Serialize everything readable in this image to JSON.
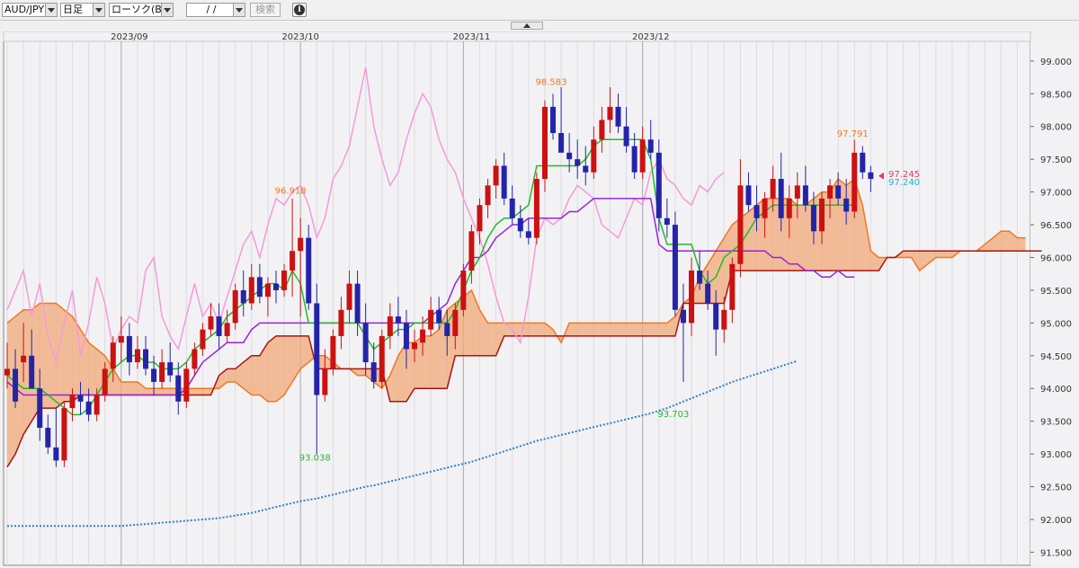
{
  "toolbar": {
    "pair": "AUD/JPY",
    "timeframe": "日足",
    "chart_type": "ローソク(BID)",
    "date_value": "/ /",
    "search_label": "検索",
    "info_glyph": "i"
  },
  "chart_data": {
    "type": "candlestick",
    "x_labels": [
      "2023/09",
      "2023/10",
      "2023/11",
      "2023/12"
    ],
    "y_ticks": [
      "99.000",
      "98.500",
      "98.000",
      "97.500",
      "97.000",
      "96.500",
      "96.000",
      "95.500",
      "95.000",
      "94.500",
      "94.000",
      "93.500",
      "93.000",
      "92.500",
      "92.000",
      "91.500"
    ],
    "ylim": [
      91.3,
      99.3
    ],
    "annotations": [
      {
        "text": "96.918",
        "value": 96.918,
        "color": "#f07820"
      },
      {
        "text": "93.038",
        "value": 93.038,
        "color": "#22bb22"
      },
      {
        "text": "98.583",
        "value": 98.583,
        "color": "#f07820"
      },
      {
        "text": "93.703",
        "value": 93.703,
        "color": "#22bb22"
      },
      {
        "text": "97.791",
        "value": 97.791,
        "color": "#f07820"
      }
    ],
    "price_labels": [
      {
        "text": "97.245",
        "value": 97.245,
        "color": "#e8386a"
      },
      {
        "text": "97.240",
        "value": 97.24,
        "color": "#29a8e0"
      }
    ],
    "colors": {
      "up": "#cc1111",
      "down": "#2424aa",
      "tenkan": "#22bb22",
      "kijun": "#9a22dd",
      "chikou": "#f59ad8",
      "span_a": "#f07820",
      "span_b": "#aa1414",
      "cloud": "#f2a878",
      "ma": "#2e7fd0"
    },
    "ohlc": [
      [
        94.2,
        94.7,
        94.0,
        94.3
      ],
      [
        94.3,
        94.6,
        93.7,
        93.8
      ],
      [
        94.4,
        95.0,
        94.1,
        94.5
      ],
      [
        94.5,
        94.9,
        94.3,
        94.0
      ],
      [
        94.0,
        94.3,
        93.2,
        93.4
      ],
      [
        93.4,
        93.6,
        93.0,
        93.1
      ],
      [
        93.1,
        93.7,
        92.8,
        92.9
      ],
      [
        92.9,
        93.8,
        92.8,
        93.7
      ],
      [
        93.7,
        94.0,
        93.5,
        93.9
      ],
      [
        93.9,
        94.1,
        93.6,
        93.8
      ],
      [
        93.8,
        94.0,
        93.5,
        93.6
      ],
      [
        93.6,
        94.0,
        93.5,
        93.9
      ],
      [
        93.9,
        94.4,
        93.8,
        94.3
      ],
      [
        94.3,
        94.8,
        94.1,
        94.7
      ],
      [
        94.7,
        95.1,
        94.4,
        94.8
      ],
      [
        94.8,
        95.0,
        94.2,
        94.4
      ],
      [
        94.4,
        94.8,
        94.3,
        94.6
      ],
      [
        94.6,
        94.8,
        94.2,
        94.3
      ],
      [
        94.3,
        94.5,
        93.9,
        94.1
      ],
      [
        94.1,
        94.6,
        94.0,
        94.4
      ],
      [
        94.4,
        94.7,
        94.1,
        94.2
      ],
      [
        94.2,
        94.4,
        93.6,
        93.8
      ],
      [
        93.8,
        94.4,
        93.7,
        94.3
      ],
      [
        94.3,
        94.7,
        94.2,
        94.6
      ],
      [
        94.6,
        95.0,
        94.5,
        94.9
      ],
      [
        94.9,
        95.3,
        94.8,
        95.1
      ],
      [
        95.1,
        95.3,
        94.6,
        94.8
      ],
      [
        94.8,
        95.2,
        94.7,
        95.0
      ],
      [
        95.0,
        95.6,
        94.9,
        95.5
      ],
      [
        95.5,
        95.8,
        95.1,
        95.3
      ],
      [
        95.3,
        95.9,
        95.2,
        95.7
      ],
      [
        95.7,
        95.9,
        95.3,
        95.4
      ],
      [
        95.4,
        95.7,
        95.1,
        95.6
      ],
      [
        95.6,
        95.8,
        95.3,
        95.5
      ],
      [
        95.5,
        95.9,
        95.4,
        95.8
      ],
      [
        95.8,
        96.9,
        95.4,
        96.1
      ],
      [
        96.1,
        96.6,
        95.1,
        96.3
      ],
      [
        96.3,
        96.5,
        95.2,
        95.3
      ],
      [
        95.3,
        95.6,
        93.0,
        93.9
      ],
      [
        93.9,
        94.6,
        93.8,
        94.3
      ],
      [
        94.3,
        94.9,
        94.2,
        94.8
      ],
      [
        94.8,
        95.4,
        94.6,
        95.2
      ],
      [
        95.2,
        95.8,
        95.0,
        95.6
      ],
      [
        95.6,
        95.8,
        94.8,
        95.0
      ],
      [
        95.0,
        95.3,
        94.2,
        94.4
      ],
      [
        94.4,
        94.7,
        94.0,
        94.1
      ],
      [
        94.1,
        94.9,
        94.0,
        94.8
      ],
      [
        94.8,
        95.3,
        94.6,
        95.1
      ],
      [
        95.1,
        95.4,
        94.8,
        95.0
      ],
      [
        95.0,
        95.2,
        94.3,
        94.6
      ],
      [
        94.6,
        94.9,
        94.4,
        94.7
      ],
      [
        94.7,
        95.1,
        94.5,
        94.9
      ],
      [
        94.9,
        95.4,
        94.8,
        95.2
      ],
      [
        95.2,
        95.4,
        94.9,
        95.0
      ],
      [
        95.0,
        95.2,
        94.5,
        94.8
      ],
      [
        94.8,
        95.3,
        94.6,
        95.2
      ],
      [
        95.2,
        95.9,
        95.1,
        95.8
      ],
      [
        95.8,
        96.5,
        95.6,
        96.4
      ],
      [
        96.4,
        96.9,
        96.2,
        96.8
      ],
      [
        96.8,
        97.2,
        96.6,
        97.1
      ],
      [
        97.1,
        97.5,
        96.9,
        97.4
      ],
      [
        97.4,
        97.6,
        96.8,
        96.9
      ],
      [
        96.9,
        97.1,
        96.5,
        96.6
      ],
      [
        96.6,
        96.8,
        96.3,
        96.4
      ],
      [
        96.4,
        96.6,
        96.2,
        96.3
      ],
      [
        96.3,
        97.3,
        96.2,
        97.2
      ],
      [
        97.2,
        98.4,
        97.0,
        98.3
      ],
      [
        98.3,
        98.5,
        97.8,
        97.9
      ],
      [
        97.9,
        98.6,
        97.7,
        97.6
      ],
      [
        97.6,
        97.9,
        97.3,
        97.5
      ],
      [
        97.5,
        97.8,
        97.2,
        97.4
      ],
      [
        97.4,
        97.7,
        97.1,
        97.3
      ],
      [
        97.3,
        98.0,
        97.2,
        97.8
      ],
      [
        97.8,
        98.3,
        97.6,
        98.1
      ],
      [
        98.1,
        98.6,
        97.9,
        98.3
      ],
      [
        98.3,
        98.5,
        97.9,
        98.0
      ],
      [
        98.0,
        98.3,
        97.6,
        97.7
      ],
      [
        97.7,
        97.9,
        97.2,
        97.3
      ],
      [
        97.3,
        98.0,
        97.2,
        97.8
      ],
      [
        97.8,
        98.1,
        97.5,
        97.6
      ],
      [
        97.6,
        97.8,
        96.4,
        96.6
      ],
      [
        96.6,
        96.9,
        96.3,
        96.5
      ],
      [
        96.5,
        96.7,
        95.1,
        95.2
      ],
      [
        95.2,
        95.6,
        94.1,
        95.0
      ],
      [
        95.0,
        96.0,
        94.8,
        95.8
      ],
      [
        95.8,
        96.1,
        95.5,
        95.6
      ],
      [
        95.6,
        95.8,
        95.2,
        95.3
      ],
      [
        95.3,
        95.5,
        94.5,
        94.9
      ],
      [
        94.9,
        95.4,
        94.7,
        95.2
      ],
      [
        95.2,
        96.0,
        95.0,
        95.9
      ],
      [
        95.9,
        97.5,
        95.7,
        97.1
      ],
      [
        97.1,
        97.3,
        96.7,
        96.8
      ],
      [
        96.8,
        97.1,
        96.4,
        96.6
      ],
      [
        96.6,
        97.0,
        96.3,
        96.9
      ],
      [
        96.9,
        97.4,
        96.7,
        97.2
      ],
      [
        97.2,
        97.6,
        96.4,
        96.6
      ],
      [
        96.6,
        97.1,
        96.3,
        96.9
      ],
      [
        96.9,
        97.3,
        96.6,
        97.1
      ],
      [
        97.1,
        97.4,
        96.7,
        96.8
      ],
      [
        96.8,
        97.0,
        96.2,
        96.4
      ],
      [
        96.4,
        97.0,
        96.2,
        96.9
      ],
      [
        96.9,
        97.2,
        96.6,
        97.1
      ],
      [
        97.1,
        97.3,
        96.8,
        96.9
      ],
      [
        96.9,
        97.2,
        96.5,
        96.7
      ],
      [
        96.7,
        97.8,
        96.6,
        97.6
      ],
      [
        97.6,
        97.7,
        97.2,
        97.3
      ],
      [
        97.3,
        97.4,
        97.0,
        97.2
      ]
    ],
    "tenkan": [
      94.2,
      94.1,
      94.0,
      94.0,
      94.0,
      93.9,
      93.8,
      93.7,
      93.6,
      93.6,
      93.7,
      93.9,
      94.1,
      94.3,
      94.4,
      94.5,
      94.5,
      94.4,
      94.4,
      94.3,
      94.3,
      94.3,
      94.4,
      94.6,
      94.7,
      94.8,
      94.9,
      95.1,
      95.2,
      95.3,
      95.4,
      95.5,
      95.6,
      95.6,
      95.5,
      95.8,
      95.6,
      95.0,
      95.0,
      95.0,
      95.0,
      95.0,
      95.0,
      95.0,
      94.8,
      94.6,
      94.7,
      94.8,
      94.9,
      94.9,
      95.0,
      95.0,
      95.0,
      95.0,
      95.0,
      95.2,
      95.5,
      95.8,
      96.0,
      96.3,
      96.5,
      96.6,
      96.6,
      96.7,
      96.8,
      97.4,
      97.4,
      97.4,
      97.4,
      97.4,
      97.4,
      97.5,
      97.7,
      97.8,
      97.8,
      97.8,
      97.8,
      97.8,
      97.8,
      97.5,
      96.6,
      96.2,
      96.2,
      96.2,
      96.2,
      95.8,
      95.6,
      95.7,
      96.0,
      96.1,
      96.2,
      96.4,
      96.6,
      96.7,
      96.8,
      96.8,
      96.8,
      96.8,
      96.8,
      96.8,
      96.8,
      96.8,
      96.8,
      96.8,
      96.8
    ],
    "kijun": [
      94.1,
      94.0,
      93.9,
      93.9,
      93.9,
      93.9,
      93.9,
      93.9,
      93.9,
      93.9,
      93.9,
      93.9,
      93.9,
      93.9,
      93.9,
      93.9,
      93.9,
      93.9,
      93.9,
      93.9,
      93.9,
      93.9,
      94.0,
      94.2,
      94.4,
      94.5,
      94.6,
      94.7,
      94.7,
      94.7,
      94.9,
      95.0,
      95.0,
      95.0,
      95.0,
      95.0,
      95.0,
      95.0,
      95.0,
      95.0,
      95.0,
      95.0,
      95.0,
      95.0,
      95.0,
      95.0,
      95.0,
      95.0,
      95.0,
      95.0,
      95.0,
      95.0,
      95.1,
      95.2,
      95.3,
      95.6,
      95.8,
      96.0,
      96.0,
      96.1,
      96.3,
      96.4,
      96.5,
      96.5,
      96.6,
      96.6,
      96.6,
      96.6,
      96.6,
      96.7,
      96.7,
      96.8,
      96.9,
      96.9,
      96.9,
      96.9,
      96.9,
      96.9,
      96.9,
      96.9,
      96.2,
      96.1,
      96.1,
      96.1,
      96.1,
      96.1,
      96.1,
      96.1,
      96.1,
      96.1,
      96.1,
      96.1,
      96.1,
      96.1,
      96.0,
      96.0,
      95.9,
      95.9,
      95.8,
      95.8,
      95.7,
      95.7,
      95.8,
      95.7,
      95.7
    ],
    "chikou": [
      95.2,
      95.5,
      95.8,
      95.1,
      95.6,
      94.8,
      94.4,
      95.0,
      95.5,
      94.5,
      95.0,
      95.7,
      95.3,
      94.6,
      94.9,
      95.1,
      95.0,
      95.8,
      96.0,
      95.1,
      94.8,
      94.6,
      95.1,
      95.6,
      95.1,
      95.3,
      95.0,
      95.4,
      95.8,
      96.2,
      96.4,
      96.0,
      96.5,
      96.9,
      96.8,
      97.0,
      97.1,
      96.8,
      96.3,
      96.6,
      97.2,
      97.4,
      97.7,
      98.3,
      98.9,
      98.0,
      97.5,
      97.1,
      97.3,
      97.8,
      98.2,
      98.5,
      98.3,
      97.8,
      97.5,
      97.3,
      96.9,
      96.6,
      96.3,
      95.9,
      95.4,
      95.0,
      94.9,
      94.7,
      95.4,
      96.3,
      96.6,
      96.5,
      96.6,
      96.9,
      97.1,
      97.0,
      96.9,
      96.5,
      96.4,
      96.3,
      96.6,
      96.9,
      96.8,
      97.3,
      97.5,
      97.2,
      97.1,
      96.9,
      96.8,
      97.1,
      97.0,
      97.2,
      97.3
    ],
    "span_a": [
      95.0,
      95.1,
      95.2,
      95.2,
      95.3,
      95.3,
      95.3,
      95.2,
      95.1,
      94.9,
      94.7,
      94.6,
      94.5,
      94.3,
      94.1,
      94.1,
      94.1,
      94.0,
      94.0,
      94.0,
      94.0,
      94.0,
      94.0,
      94.0,
      94.0,
      94.0,
      94.0,
      94.1,
      94.1,
      94.0,
      93.9,
      93.9,
      93.8,
      93.8,
      93.9,
      94.1,
      94.3,
      94.4,
      94.5,
      94.5,
      94.4,
      94.3,
      94.3,
      94.2,
      94.2,
      94.1,
      94.0,
      94.2,
      94.5,
      94.7,
      94.7,
      94.8,
      94.8,
      94.9,
      95.2,
      95.3,
      95.4,
      95.5,
      95.2,
      95.0,
      95.0,
      95.0,
      95.0,
      95.0,
      95.0,
      95.0,
      95.0,
      94.9,
      94.7,
      95.0,
      95.0,
      95.0,
      95.0,
      95.0,
      95.0,
      95.0,
      95.0,
      95.0,
      95.0,
      95.0,
      95.0,
      95.0,
      95.1,
      95.3,
      95.4,
      95.7,
      95.9,
      96.1,
      96.3,
      96.5,
      96.6,
      96.7,
      96.8,
      96.9,
      96.9,
      96.9,
      96.9,
      96.8,
      96.8,
      96.9,
      97.0,
      97.0,
      97.2,
      97.1,
      97.2,
      96.8,
      96.1,
      96.0,
      96.0,
      96.0,
      96.0,
      96.0,
      95.8,
      95.9,
      96.0,
      96.0,
      96.0,
      96.1,
      96.1,
      96.1,
      96.2,
      96.3,
      96.4,
      96.4,
      96.3,
      96.3
    ],
    "span_b": [
      92.8,
      93.0,
      93.3,
      93.5,
      93.7,
      93.7,
      93.7,
      93.8,
      93.8,
      93.9,
      93.9,
      93.9,
      93.9,
      93.9,
      93.9,
      93.9,
      93.9,
      93.9,
      93.9,
      93.9,
      93.9,
      93.9,
      93.9,
      93.9,
      93.9,
      93.9,
      94.2,
      94.3,
      94.3,
      94.4,
      94.5,
      94.5,
      94.7,
      94.8,
      94.8,
      94.8,
      94.8,
      94.8,
      94.3,
      94.3,
      94.3,
      94.3,
      94.3,
      94.3,
      94.3,
      94.3,
      94.3,
      93.8,
      93.8,
      93.8,
      94.0,
      94.0,
      94.0,
      94.0,
      94.0,
      94.5,
      94.5,
      94.5,
      94.5,
      94.5,
      94.5,
      94.8,
      94.8,
      94.8,
      94.8,
      94.8,
      94.8,
      94.8,
      94.8,
      94.8,
      94.8,
      94.8,
      94.8,
      94.8,
      94.8,
      94.8,
      94.8,
      94.8,
      94.8,
      94.8,
      94.8,
      94.8,
      94.8,
      95.3,
      95.3,
      95.3,
      95.3,
      95.3,
      95.3,
      95.8,
      95.8,
      95.8,
      95.8,
      95.8,
      95.8,
      95.8,
      95.8,
      95.8,
      95.8,
      95.8,
      95.8,
      95.8,
      95.8,
      95.8,
      95.8,
      95.8,
      95.8,
      95.8,
      96.0,
      96.0,
      96.1,
      96.1,
      96.1,
      96.1,
      96.1,
      96.1,
      96.1,
      96.1,
      96.1,
      96.1,
      96.1,
      96.1,
      96.1,
      96.1,
      96.1,
      96.1,
      96.1,
      96.1
    ],
    "ma": [
      91.9,
      91.9,
      91.9,
      91.9,
      91.9,
      91.9,
      91.9,
      91.9,
      91.9,
      91.9,
      91.9,
      91.9,
      91.9,
      91.9,
      91.9,
      91.91,
      91.92,
      91.93,
      91.94,
      91.95,
      91.96,
      91.97,
      91.98,
      91.99,
      92.0,
      92.01,
      92.02,
      92.04,
      92.06,
      92.08,
      92.1,
      92.13,
      92.16,
      92.19,
      92.22,
      92.25,
      92.28,
      92.3,
      92.32,
      92.35,
      92.38,
      92.41,
      92.44,
      92.47,
      92.5,
      92.52,
      92.55,
      92.58,
      92.61,
      92.64,
      92.67,
      92.7,
      92.73,
      92.76,
      92.79,
      92.82,
      92.85,
      92.88,
      92.92,
      92.96,
      93.0,
      93.04,
      93.08,
      93.12,
      93.16,
      93.2,
      93.23,
      93.26,
      93.29,
      93.32,
      93.35,
      93.38,
      93.41,
      93.44,
      93.47,
      93.5,
      93.53,
      93.56,
      93.59,
      93.62,
      93.66,
      93.7,
      93.75,
      93.8,
      93.85,
      93.9,
      93.95,
      94.0,
      94.05,
      94.1,
      94.14,
      94.18,
      94.22,
      94.26,
      94.3,
      94.34,
      94.38,
      94.42
    ]
  }
}
